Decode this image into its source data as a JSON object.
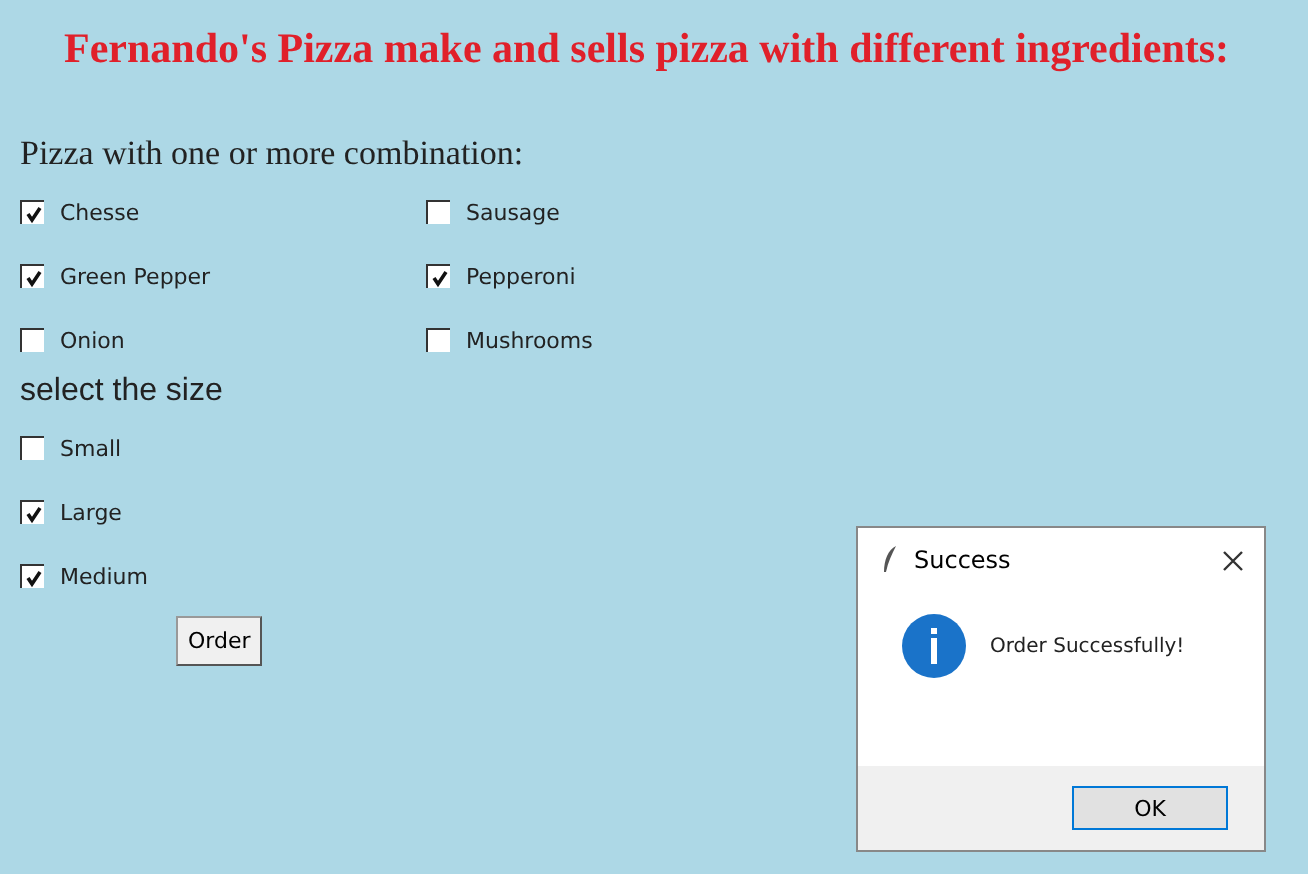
{
  "heading": "Fernando's Pizza make and sells pizza with different ingredients:",
  "toppings_label": "Pizza with one or more combination:",
  "toppings": [
    {
      "label": "Chesse",
      "checked": true
    },
    {
      "label": "Sausage",
      "checked": false
    },
    {
      "label": "Green Pepper",
      "checked": true
    },
    {
      "label": "Pepperoni",
      "checked": true
    },
    {
      "label": "Onion",
      "checked": false
    },
    {
      "label": "Mushrooms",
      "checked": false
    }
  ],
  "size_label": "select the size",
  "sizes": [
    {
      "label": "Small",
      "checked": false
    },
    {
      "label": "Large",
      "checked": true
    },
    {
      "label": "Medium",
      "checked": true
    }
  ],
  "order_button": "Order",
  "dialog": {
    "title": "Success",
    "message": "Order Successfully!",
    "button": "OK"
  }
}
